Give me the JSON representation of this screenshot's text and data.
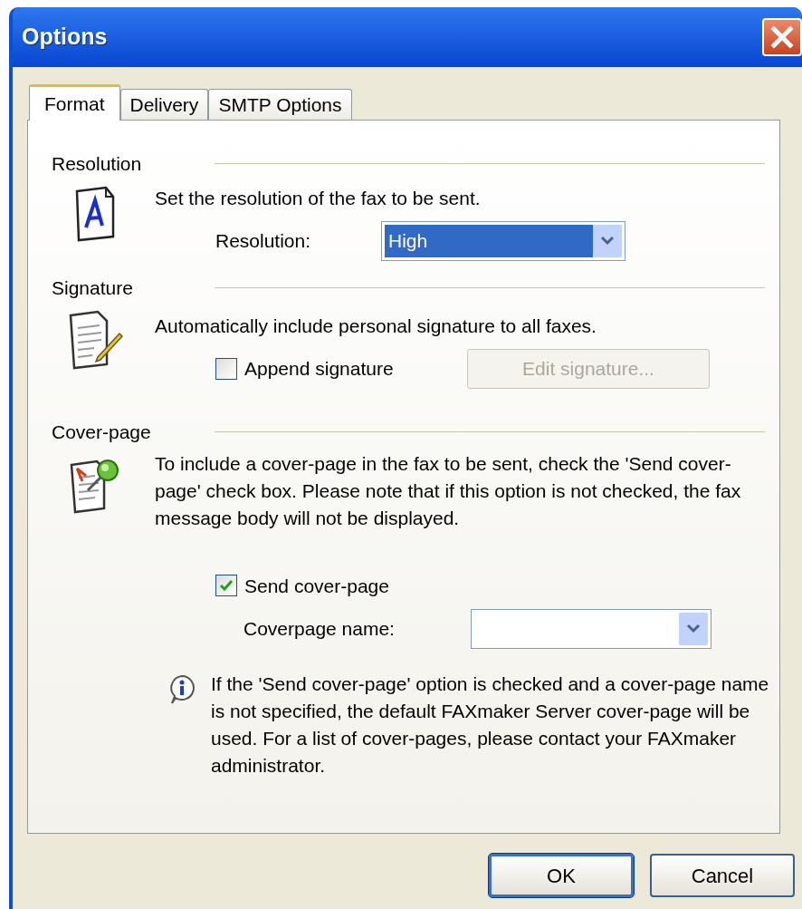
{
  "window": {
    "title": "Options"
  },
  "tabs": [
    {
      "label": "Format",
      "selected": true
    },
    {
      "label": "Delivery",
      "selected": false
    },
    {
      "label": "SMTP Options",
      "selected": false
    }
  ],
  "resolution": {
    "heading": "Resolution",
    "description": "Set the resolution of the fax to be sent.",
    "label": "Resolution:",
    "value": "High"
  },
  "signature": {
    "heading": "Signature",
    "description": "Automatically include personal signature to all faxes.",
    "checkbox": {
      "label": "Append signature",
      "checked": false
    },
    "button": {
      "label": "Edit signature...",
      "disabled": true
    }
  },
  "cover_page": {
    "heading": "Cover-page",
    "description": "To include a cover-page in the fax to be sent, check the 'Send cover-page' check box. Please note that if this option is not checked, the fax message body will not be displayed.",
    "checkbox": {
      "label": "Send cover-page",
      "checked": true
    },
    "label": "Coverpage name:",
    "note": "If the 'Send cover-page' option is checked and a cover-page name is not specified, the default FAXmaker Server cover-page will be used. For a list of cover-pages, please contact your FAXmaker administrator."
  },
  "buttons": [
    {
      "label": "OK",
      "default": true
    },
    {
      "label": "Cancel",
      "default": false
    }
  ]
}
